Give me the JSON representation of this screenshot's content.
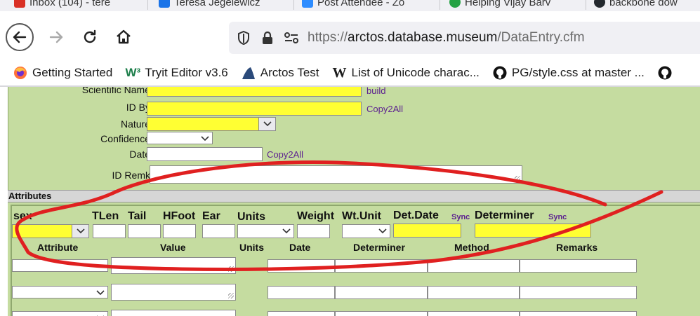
{
  "tabs": [
    {
      "label": "Inbox (104) - tere",
      "color": "#d93025"
    },
    {
      "label": "Teresa Jegelewicz",
      "color": "#0b8043"
    },
    {
      "label": "Post Attendee - Zo",
      "color": "#2d8cff"
    },
    {
      "label": "Helping Vijay Barv",
      "color": "#25a244"
    },
    {
      "label": "backbone dow",
      "color": "#24292e"
    }
  ],
  "nav": {
    "url_prefix": "https://",
    "url_domain": "arctos.database.museum",
    "url_path": "/DataEntry.cfm"
  },
  "bookmarks": [
    {
      "label": "Getting Started",
      "icon": "firefox-icon"
    },
    {
      "label": "Tryit Editor v3.6",
      "icon": "w3schools-icon"
    },
    {
      "label": "Arctos Test",
      "icon": "arctos-icon"
    },
    {
      "label": "List of Unicode charac...",
      "icon": "wikipedia-icon"
    },
    {
      "label": "PG/style.css at master ...",
      "icon": "github-icon"
    }
  ],
  "identification": {
    "scientific_name_label": "Scientific Name",
    "build_link": "build",
    "id_by_label": "ID By",
    "copy2all_1": "Copy2All",
    "nature_label": "Nature",
    "confidence_label": "Confidence",
    "date_label": "Date",
    "copy2all_2": "Copy2All",
    "id_remk_label": "ID Remk"
  },
  "attributes": {
    "section_title": "Attributes",
    "headers": {
      "sex": "sex",
      "tlen": "TLen",
      "tail": "Tail",
      "hfoot": "HFoot",
      "ear": "Ear",
      "units": "Units",
      "weight": "Weight",
      "wt_unit": "Wt.Unit",
      "det_date": "Det.Date",
      "sync1": "Sync",
      "determiner": "Determiner",
      "sync2": "Sync"
    },
    "columns": {
      "attribute": "Attribute",
      "value": "Value",
      "units": "Units",
      "date": "Date",
      "determiner": "Determiner",
      "method": "Method",
      "remarks": "Remarks"
    }
  },
  "colors": {
    "form_green": "#c5dca0",
    "required_yellow": "#ffff33",
    "link_purple": "#5b1f8f",
    "annotation_red": "#e02020"
  }
}
